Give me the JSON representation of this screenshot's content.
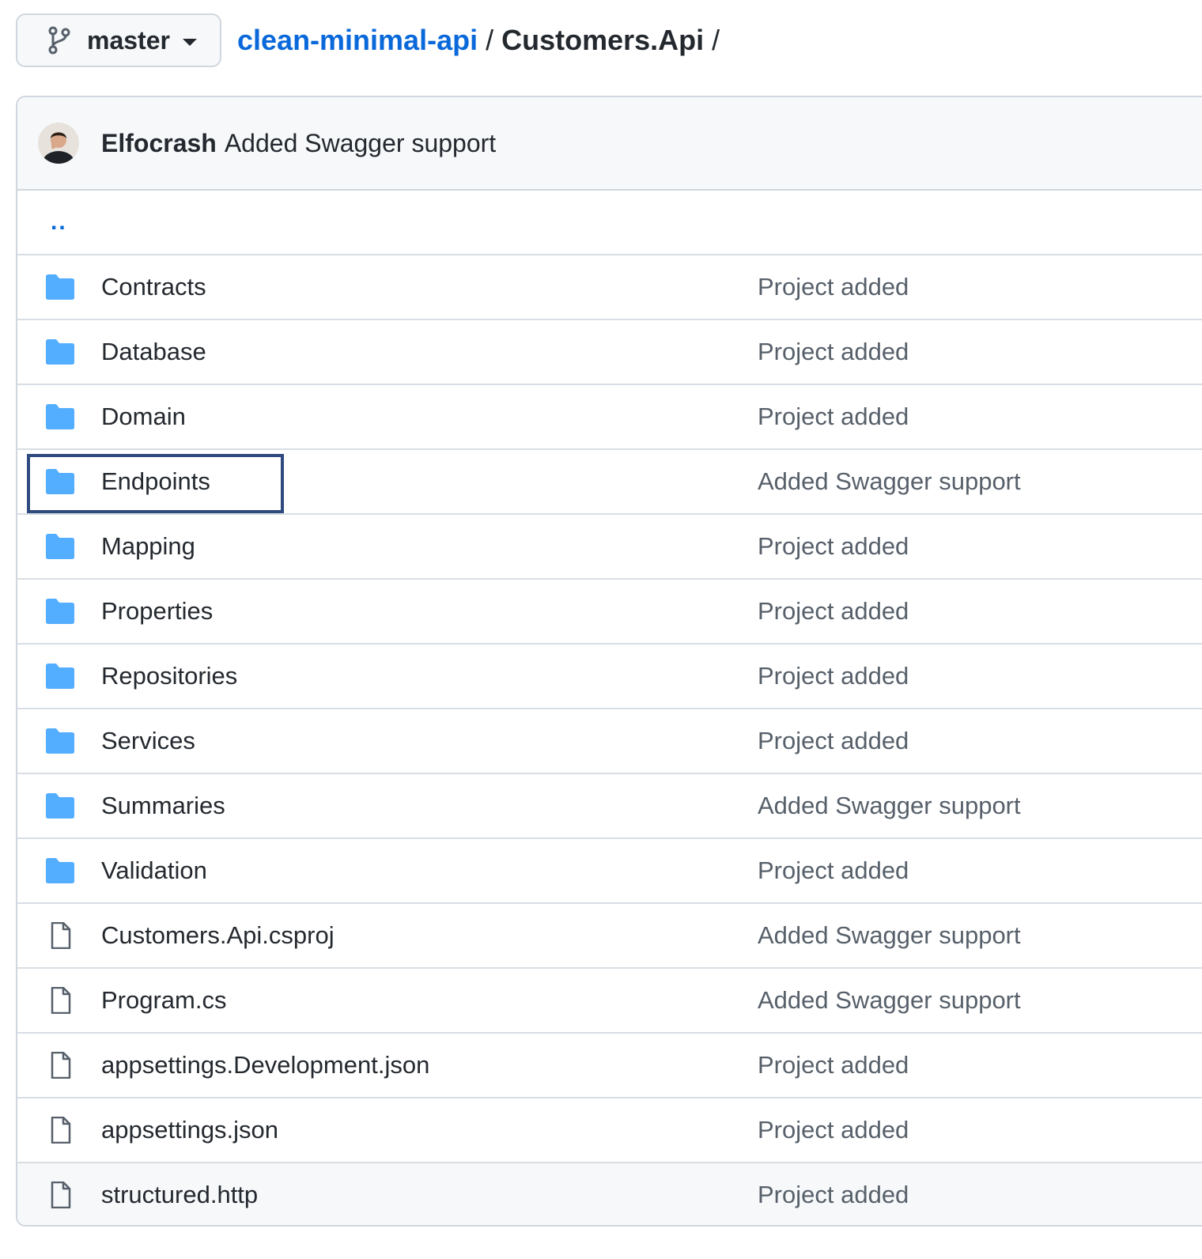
{
  "branch": {
    "name": "master",
    "icon": "git-branch-icon"
  },
  "breadcrumb": {
    "repo": "clean-minimal-api",
    "sep1": "/",
    "folder": "Customers.Api",
    "sep2": "/"
  },
  "commit": {
    "author": "Elfocrash",
    "message": "Added Swagger support"
  },
  "up_link": "..",
  "colors": {
    "link": "#0969da",
    "folder_icon": "#54aeff",
    "highlight": "#2e4a7f"
  },
  "entries": [
    {
      "type": "folder",
      "name": "Contracts",
      "message": "Project added"
    },
    {
      "type": "folder",
      "name": "Database",
      "message": "Project added"
    },
    {
      "type": "folder",
      "name": "Domain",
      "message": "Project added"
    },
    {
      "type": "folder",
      "name": "Endpoints",
      "message": "Added Swagger support",
      "highlighted": true
    },
    {
      "type": "folder",
      "name": "Mapping",
      "message": "Project added"
    },
    {
      "type": "folder",
      "name": "Properties",
      "message": "Project added"
    },
    {
      "type": "folder",
      "name": "Repositories",
      "message": "Project added"
    },
    {
      "type": "folder",
      "name": "Services",
      "message": "Project added"
    },
    {
      "type": "folder",
      "name": "Summaries",
      "message": "Added Swagger support"
    },
    {
      "type": "folder",
      "name": "Validation",
      "message": "Project added"
    },
    {
      "type": "file",
      "name": "Customers.Api.csproj",
      "message": "Added Swagger support"
    },
    {
      "type": "file",
      "name": "Program.cs",
      "message": "Added Swagger support"
    },
    {
      "type": "file",
      "name": "appsettings.Development.json",
      "message": "Project added"
    },
    {
      "type": "file",
      "name": "appsettings.json",
      "message": "Project added"
    },
    {
      "type": "file",
      "name": "structured.http",
      "message": "Project added"
    }
  ]
}
